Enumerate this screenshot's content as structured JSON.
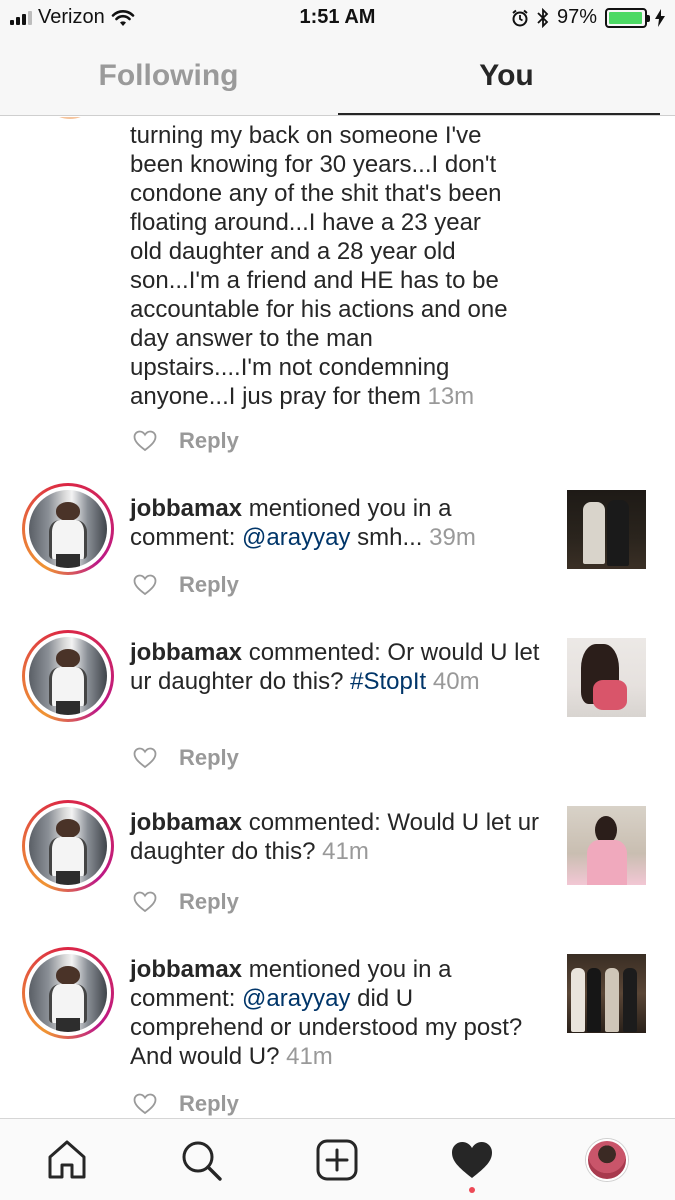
{
  "status_bar": {
    "carrier": "Verizon",
    "time": "1:51 AM",
    "battery": "97%",
    "battery_level": 0.97,
    "icons": [
      "signal-bars-icon",
      "wifi-icon",
      "alarm-icon",
      "bluetooth-icon",
      "battery-icon",
      "charging-bolt-icon"
    ]
  },
  "tabs": [
    {
      "label": "Following",
      "active": false
    },
    {
      "label": "You",
      "active": true
    }
  ],
  "feed": {
    "first_item": {
      "lines": [
        "turning my back on someone I've",
        "been knowing for 30 years...I don't",
        "condone any of the shit that's been",
        "floating around...I have a 23 year",
        "old daughter and a 28 year old",
        "son...I'm a friend and HE has to be",
        "accountable for his actions and one",
        "day answer to the man",
        "upstairs....I'm not condemning"
      ],
      "last_line": "anyone...I jus pray for them",
      "time": "13m",
      "reply_label": "Reply"
    },
    "items": [
      {
        "username": "jobbamax",
        "action": " mentioned you in a comment: ",
        "mention": "@arayyay",
        "text": " smh...",
        "time": "39m",
        "reply_label": "Reply"
      },
      {
        "username": "jobbamax",
        "action": " commented: Or would U let ur daughter do this? ",
        "mention": "#StopIt",
        "text": "",
        "time": "40m",
        "reply_label": "Reply"
      },
      {
        "username": "jobbamax",
        "action": " commented: Would U let ur daughter do this? ",
        "mention": "",
        "text": "",
        "time": "41m",
        "reply_label": "Reply"
      },
      {
        "username": "jobbamax",
        "action": " mentioned you in a comment: ",
        "mention": "@arayyay",
        "text": " did U comprehend or understood my post? And would U?",
        "time": "41m",
        "reply_label": "Reply"
      }
    ]
  },
  "tabbar": {
    "icons": [
      "home-icon",
      "search-icon",
      "new-post-icon",
      "activity-heart-icon",
      "profile-icon"
    ],
    "active": "activity-heart-icon",
    "notification_color": "#ed4956"
  },
  "colors": {
    "text": "#262626",
    "mention": "#003569",
    "muted": "#999999",
    "battery_fill": "#4cd964"
  }
}
